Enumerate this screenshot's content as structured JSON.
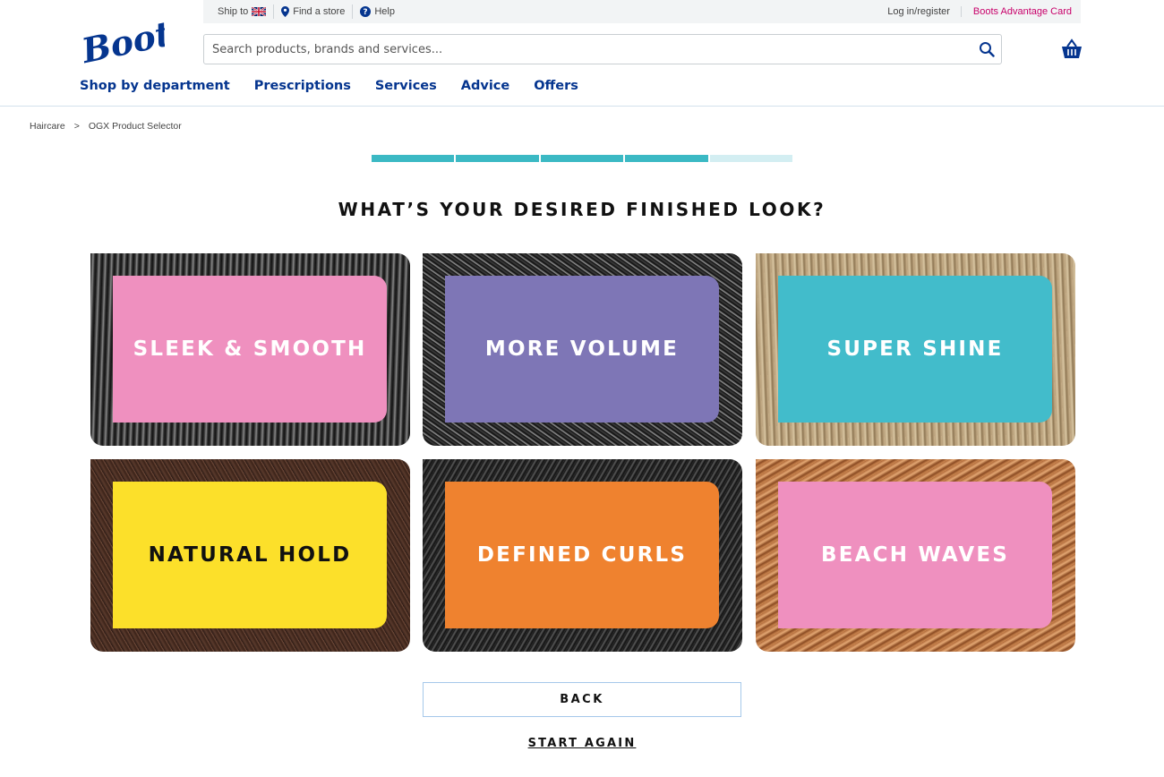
{
  "brand": {
    "name": "Boots",
    "nav_color": "#05358f",
    "accent": "#c8006a"
  },
  "utility": {
    "ship_to": "Ship to",
    "ship_flag": "uk-flag-icon",
    "find_store": "Find a store",
    "help": "Help",
    "login": "Log in/register",
    "advantage_card": "Boots Advantage Card"
  },
  "search": {
    "placeholder": "Search products, brands and services..."
  },
  "nav": {
    "items": [
      "Shop by department",
      "Prescriptions",
      "Services",
      "Advice",
      "Offers"
    ]
  },
  "breadcrumb": {
    "items": [
      "Haircare",
      "OGX Product Selector"
    ],
    "separator": ">"
  },
  "progress": {
    "total_steps": 5,
    "completed_steps": 4,
    "color": "#3bb9c4"
  },
  "question": "WHAT’S YOUR DESIRED FINISHED LOOK?",
  "options": [
    {
      "label": "SLEEK & SMOOTH",
      "color": "#ef90bf"
    },
    {
      "label": "MORE VOLUME",
      "color": "#7e76b6"
    },
    {
      "label": "SUPER SHINE",
      "color": "#42bccb"
    },
    {
      "label": "NATURAL HOLD",
      "color": "#fce02a"
    },
    {
      "label": "DEFINED CURLS",
      "color": "#ef822f"
    },
    {
      "label": "BEACH WAVES",
      "color": "#ef90bf"
    }
  ],
  "actions": {
    "back": "BACK",
    "start_again": "START AGAIN"
  }
}
